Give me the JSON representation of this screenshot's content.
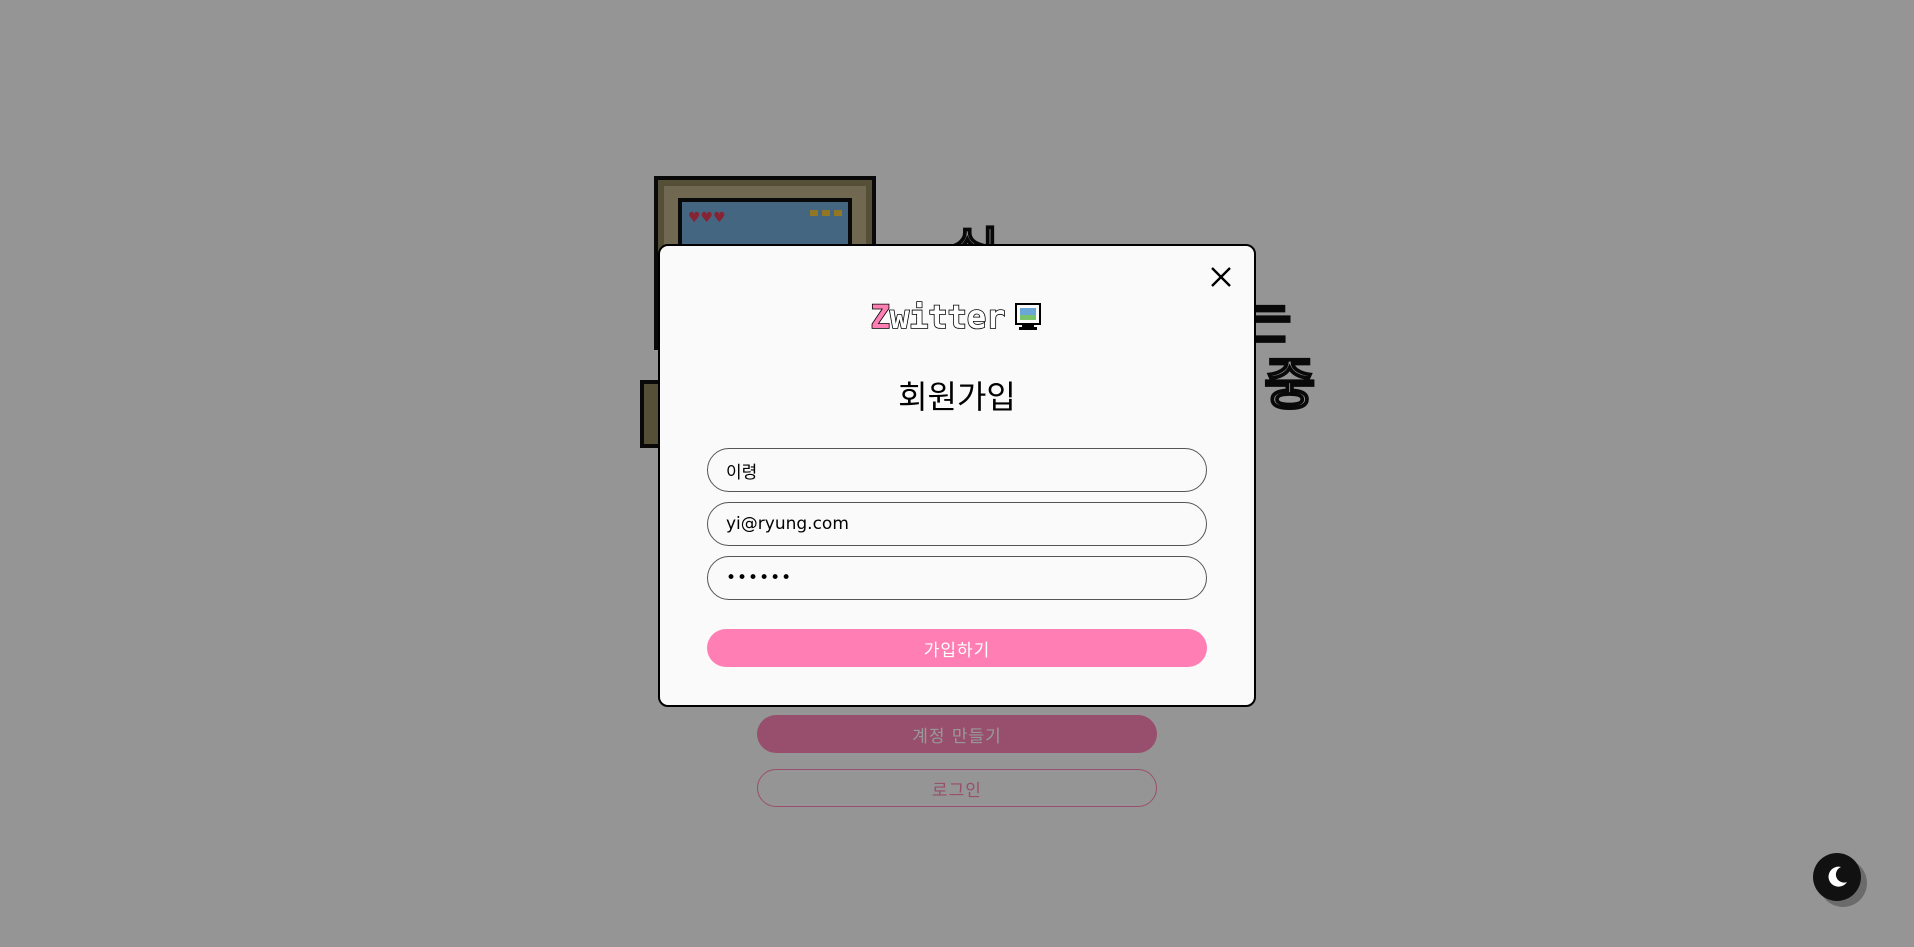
{
  "background": {
    "headline_line1": "쉬",
    "headline_line2": "는",
    "headline_line3": "중",
    "create_account_label": "계정 만들기",
    "login_label": "로그인",
    "theme_toggle_icon": "moon-icon"
  },
  "modal": {
    "logo_z": "Z",
    "logo_rest": "witter",
    "logo_icon": "computer-icon",
    "title": "회원가입",
    "close_icon": "close-icon",
    "fields": {
      "name_value": "이령",
      "email_value": "yi@ryung.com",
      "password_value": "••••••"
    },
    "submit_label": "가입하기"
  },
  "colors": {
    "accent": "#ff7eb3",
    "modal_bg": "#fafafa",
    "border": "#000000"
  }
}
